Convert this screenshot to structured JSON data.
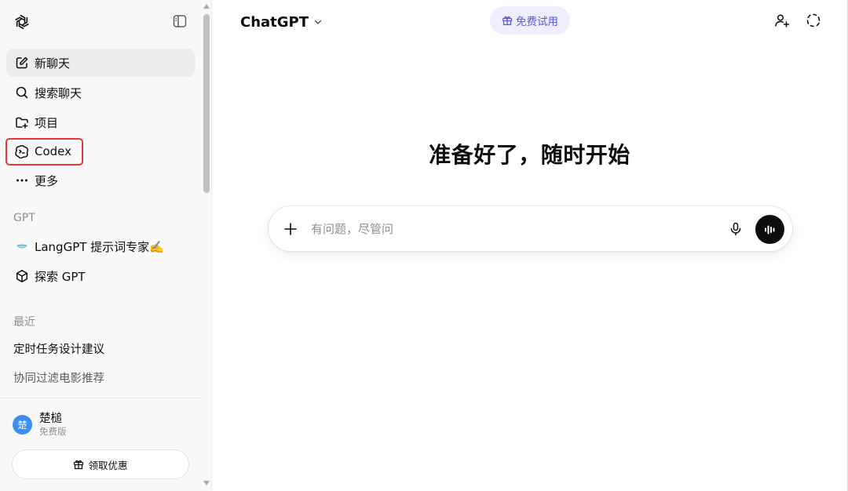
{
  "sidebar": {
    "logo_icon": "openai-logo-icon",
    "toggle_icon": "sidebar-toggle-icon",
    "nav": [
      {
        "label": "新聊天",
        "icon": "edit-icon",
        "active": true
      },
      {
        "label": "搜索聊天",
        "icon": "search-icon"
      },
      {
        "label": "项目",
        "icon": "folder-plus-icon"
      },
      {
        "label": "Codex",
        "icon": "codex-icon",
        "highlighted": true
      },
      {
        "label": "更多",
        "icon": "more-icon"
      }
    ],
    "gpt_section": {
      "label": "GPT",
      "items": [
        {
          "label": "LangGPT 提示词专家✍️",
          "icon": "langgpt-avatar-icon"
        },
        {
          "label": "探索 GPT",
          "icon": "cube-icon"
        }
      ]
    },
    "recent_section": {
      "label": "最近",
      "items": [
        "定时任务设计建议",
        "协同过滤电影推荐"
      ]
    },
    "user": {
      "avatar_text": "楚",
      "name": "楚槌",
      "plan": "免费版"
    },
    "promo_button": {
      "label": "领取优惠",
      "icon": "gift-icon"
    }
  },
  "header": {
    "model_name": "ChatGPT",
    "model_chevron": "chevron-down-icon",
    "trial_button": {
      "label": "免费试用",
      "icon": "gift-icon"
    },
    "actions": [
      {
        "name": "add-user-icon"
      },
      {
        "name": "temporary-chat-icon"
      }
    ]
  },
  "main": {
    "hero_title": "准备好了，随时开始",
    "composer": {
      "placeholder": "有问题，尽管问",
      "plus_icon": "plus-icon",
      "mic_icon": "mic-icon",
      "voice_icon": "voice-mode-icon"
    }
  },
  "colors": {
    "sidebar_bg": "#f9f9f9",
    "active_item_bg": "#ececec",
    "highlight_border": "#e53935",
    "trial_bg": "#eeeefe",
    "trial_text": "#5b5bd6",
    "avatar_bg": "#3b8ef0",
    "voice_button_bg": "#0d0d0d"
  }
}
